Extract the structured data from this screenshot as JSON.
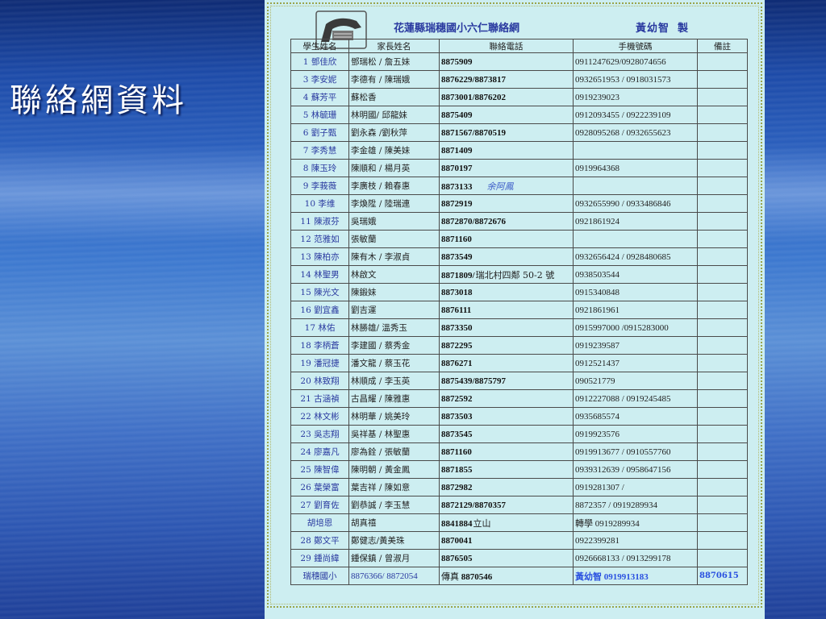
{
  "slide": {
    "title": "聯絡網資料"
  },
  "document": {
    "title": "花蓮縣瑞穗國小六仁聯絡網",
    "author": "黃幼智",
    "author_mark": "製"
  },
  "table": {
    "headers": {
      "student": "學生姓名",
      "parent": "家長姓名",
      "phone": "聯絡電話",
      "mobile": "手機號碼",
      "note": "備註"
    },
    "rows": [
      {
        "student": "1 鄧佳欣",
        "parent": "鄧瑞松 / 詹五妹",
        "phone": "8875909",
        "mobile": "0911247629/0928074656",
        "note": ""
      },
      {
        "student": "3 李安妮",
        "parent": "李德有 / 陳瑞娥",
        "phone": "8876229/8873817",
        "mobile": "0932651953 / 0918031573",
        "note": ""
      },
      {
        "student": "4 蘇芳平",
        "parent": "蘇松香",
        "phone": "8873001/8876202",
        "mobile": "0919239023",
        "note": ""
      },
      {
        "student": "5 林毓珊",
        "parent": "林明國/ 邱龍妹",
        "phone": "8875409",
        "mobile": "0912093455 / 0922239109",
        "note": ""
      },
      {
        "student": "6 劉子甄",
        "parent": "劉永森 /劉秋萍",
        "phone": "8871567/8870519",
        "mobile": "0928095268 / 0932655623",
        "note": ""
      },
      {
        "student": "7 李秀慧",
        "parent": "李金雄 / 陳美妹",
        "phone": "8871409",
        "mobile": "",
        "note": ""
      },
      {
        "student": "8 陳玉玲",
        "parent": "陳順和 / 楊月英",
        "phone": "8870197",
        "mobile": "0919964368",
        "note": ""
      },
      {
        "student": "9 李莪薇",
        "parent": "李廣枝 / 賴春惠",
        "phone": "8873133",
        "phone_note": "余阿鳳",
        "mobile": "",
        "note": ""
      },
      {
        "student": "10 李维",
        "parent": "李煥陞 / 陸瑞連",
        "phone": "8872919",
        "mobile": "0932655990 / 0933486846",
        "note": ""
      },
      {
        "student": "11 陳淑芬",
        "parent": "吳瑞娥",
        "phone": "8872870/8872676",
        "mobile": "0921861924",
        "note": ""
      },
      {
        "student": "12 范雅如",
        "parent": "張敏蘭",
        "phone": "8871160",
        "mobile": "",
        "note": ""
      },
      {
        "student": "13 陳柏亦",
        "parent": "陳有木 / 李淑貞",
        "phone": "8873549",
        "mobile": "0932656424 / 0928480685",
        "note": ""
      },
      {
        "student": "14 林聖男",
        "parent": "林啟文",
        "phone": "8871809/",
        "phone_note": "瑞北村四鄰 50-2 號",
        "mobile": "0938503544",
        "note": ""
      },
      {
        "student": "15 陳光文",
        "parent": "陳鍛妹",
        "phone": "8873018",
        "mobile": "0915340848",
        "note": ""
      },
      {
        "student": "16 劉宜鑫",
        "parent": "劉吉運",
        "phone": "8876111",
        "mobile": "0921861961",
        "note": ""
      },
      {
        "student": "17 林佑",
        "parent": "林勝雄/ 溫秀玉",
        "phone": "8873350",
        "mobile": "0915997000 /0915283000",
        "note": ""
      },
      {
        "student": "18 李柄蒼",
        "parent": "李建國 / 蔡秀金",
        "phone": "8872295",
        "mobile": "0919239587",
        "note": ""
      },
      {
        "student": "19 潘冠捷",
        "parent": "潘文龍 / 蔡玉花",
        "phone": "8876271",
        "mobile": "0912521437",
        "note": ""
      },
      {
        "student": "20 林致翔",
        "parent": "林順成 / 李玉英",
        "phone": "8875439/8875797",
        "mobile": "090521779",
        "note": ""
      },
      {
        "student": "21 古涵禎",
        "parent": "古昌耀 / 陳雅惠",
        "phone": "8872592",
        "mobile": "0912227088 / 0919245485",
        "note": ""
      },
      {
        "student": "22 林文彬",
        "parent": "林明華 / 姚美玲",
        "phone": "8873503",
        "mobile": "0935685574",
        "note": ""
      },
      {
        "student": "23 吳志翔",
        "parent": "吳祥基 / 林聖惠",
        "phone": "8873545",
        "mobile": "0919923576",
        "note": ""
      },
      {
        "student": "24 廖嘉凡",
        "parent": "廖為銓 / 張敏蘭",
        "phone": "8871160",
        "mobile": "0919913677 / 0910557760",
        "note": ""
      },
      {
        "student": "25 陳智偉",
        "parent": "陳明朝 / 黃金鳳",
        "phone": "8871855",
        "mobile": "0939312639 / 0958647156",
        "note": ""
      },
      {
        "student": "26 葉榮富",
        "parent": "葉吉祥 / 陳如意",
        "phone": "8872982",
        "mobile": "0919281307 /",
        "note": ""
      },
      {
        "student": "27 劉育佐",
        "parent": "劉恭誠 / 李玉慧",
        "phone": "8872129/8870357",
        "mobile": "8872357 / 0919289934",
        "note": ""
      },
      {
        "student": "胡培恩",
        "parent": "胡真禧",
        "phone": "8841884",
        "phone_note": "立山",
        "mobile": "轉學 0919289934",
        "note": ""
      },
      {
        "student": "28 鄭文平",
        "parent": "鄭健志/黃美珠",
        "phone": "8870041",
        "mobile": "0922399281",
        "note": ""
      },
      {
        "student": "29 鍾尚緯",
        "parent": "鍾保鎮 / 曾淑月",
        "phone": "8876505",
        "mobile": "0926668133 / 0913299178",
        "note": ""
      }
    ],
    "footer": {
      "student": "瑞穗國小",
      "parent": "8876366/ 8872054",
      "phone_label": "傳真",
      "phone": "8870546",
      "mobile": "黃幼智 0919913183",
      "note": "8870615"
    }
  }
}
